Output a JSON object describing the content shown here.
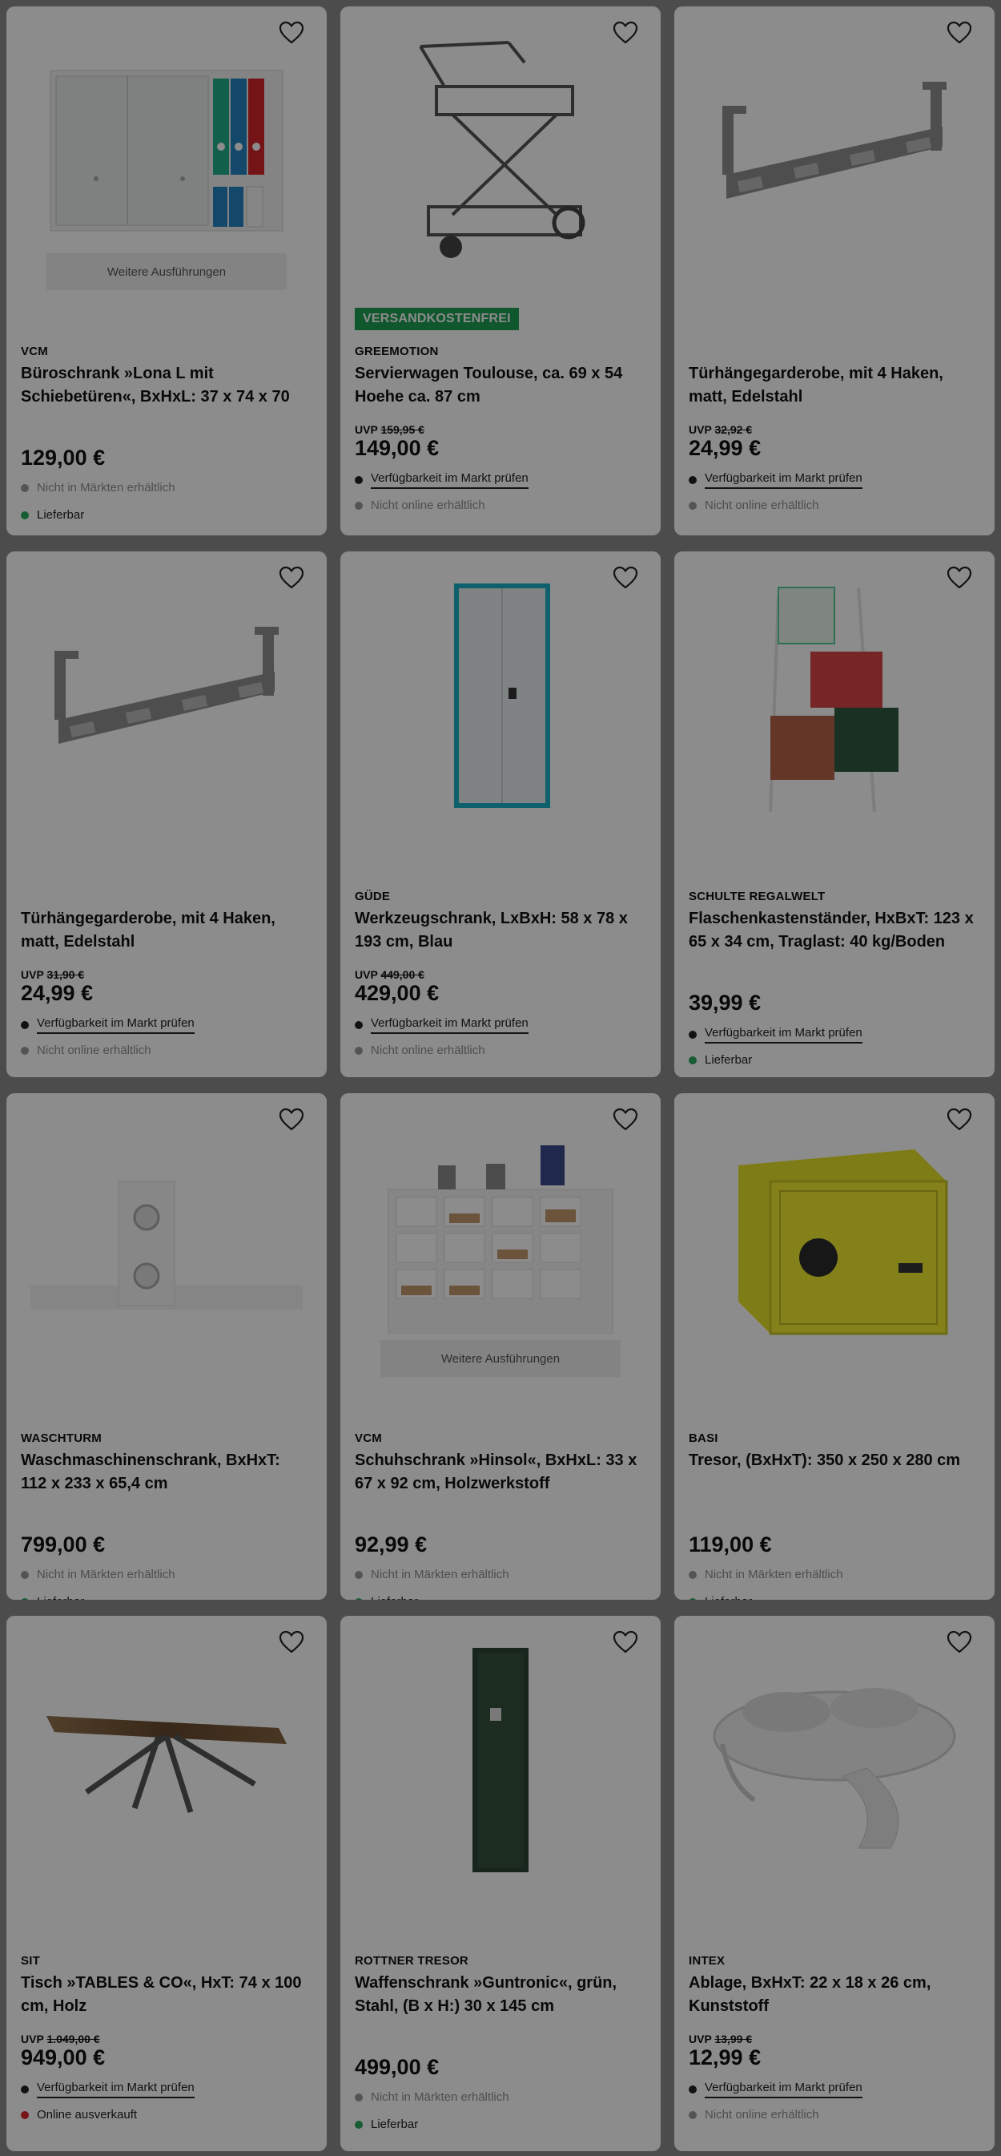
{
  "more_label": "Weitere Ausführungen",
  "colors": {
    "green": "#2aa85e",
    "red": "#d9262c",
    "dark": "#222222",
    "gray": "#9a9a9a",
    "badge": "#1e9e55"
  },
  "products": [
    {
      "brand": "VCM",
      "title": "Büroschrank »Lona L mit Schiebetüren«, BxHxL: 37 x 74 x 70 c…",
      "uvp_label": "",
      "uvp_value": "",
      "price": "129,00 €",
      "badge": "",
      "more": true,
      "image": "office-cabinet-image",
      "status": [
        {
          "text": "Nicht in Märkten erhältlich",
          "dot": "gray",
          "kind": "muted"
        },
        {
          "text": "Lieferbar",
          "dot": "green",
          "kind": "plain"
        }
      ]
    },
    {
      "brand": "GREEMOTION",
      "title": "Servierwagen Toulouse, ca. 69 x 54 Hoehe ca. 87 cm",
      "uvp_label": "UVP",
      "uvp_value": "159,95 €",
      "price": "149,00 €",
      "badge": "VERSANDKOSTENFREI",
      "more": false,
      "image": "serving-cart-image",
      "status": [
        {
          "text": "Verfügbarkeit im Markt prüfen",
          "dot": "dark",
          "kind": "link"
        },
        {
          "text": "Nicht online erhältlich",
          "dot": "gray",
          "kind": "muted"
        }
      ]
    },
    {
      "brand": "",
      "title": "Türhängegarderobe, mit 4 Haken, matt, Edelstahl",
      "uvp_label": "UVP",
      "uvp_value": "32,92 €",
      "price": "24,99 €",
      "badge": "",
      "more": false,
      "image": "door-hook-rack-image",
      "status": [
        {
          "text": "Verfügbarkeit im Markt prüfen",
          "dot": "dark",
          "kind": "link"
        },
        {
          "text": "Nicht online erhältlich",
          "dot": "gray",
          "kind": "muted"
        }
      ]
    },
    {
      "brand": "",
      "title": "Türhängegarderobe, mit 4 Haken, matt, Edelstahl",
      "uvp_label": "UVP",
      "uvp_value": "31,90 €",
      "price": "24,99 €",
      "badge": "",
      "more": false,
      "image": "door-hook-rack-image",
      "status": [
        {
          "text": "Verfügbarkeit im Markt prüfen",
          "dot": "dark",
          "kind": "link"
        },
        {
          "text": "Nicht online erhältlich",
          "dot": "gray",
          "kind": "muted"
        }
      ]
    },
    {
      "brand": "GÜDE",
      "title": "Werkzeugschrank, LxBxH: 58 x 78 x 193 cm, Blau",
      "uvp_label": "UVP",
      "uvp_value": "449,00 €",
      "price": "429,00 €",
      "badge": "",
      "more": false,
      "image": "tool-cabinet-image",
      "status": [
        {
          "text": "Verfügbarkeit im Markt prüfen",
          "dot": "dark",
          "kind": "link"
        },
        {
          "text": "Nicht online erhältlich",
          "dot": "gray",
          "kind": "muted"
        }
      ]
    },
    {
      "brand": "SCHULTE REGALWELT",
      "title": "Flaschenkastenständer, HxBxT: 123 x 65 x 34 cm, Traglast: 40 kg/Boden",
      "uvp_label": "",
      "uvp_value": "",
      "price": "39,99 €",
      "badge": "",
      "more": false,
      "image": "crate-stand-image",
      "status": [
        {
          "text": "Verfügbarkeit im Markt prüfen",
          "dot": "dark",
          "kind": "link"
        },
        {
          "text": "Lieferbar",
          "dot": "green",
          "kind": "plain"
        }
      ]
    },
    {
      "brand": "WASCHTURM",
      "title": "Waschmaschinenschrank, BxHxT: 112 x 233 x 65,4 cm",
      "uvp_label": "",
      "uvp_value": "",
      "price": "799,00 €",
      "badge": "",
      "more": false,
      "image": "washer-cabinet-image",
      "status": [
        {
          "text": "Nicht in Märkten erhältlich",
          "dot": "gray",
          "kind": "muted"
        },
        {
          "text": "Lieferbar",
          "dot": "green",
          "kind": "plain"
        }
      ]
    },
    {
      "brand": "VCM",
      "title": "Schuhschrank »Hinsol«, BxHxL: 33 x 67 x 92 cm, Holzwerkstoff",
      "uvp_label": "",
      "uvp_value": "",
      "price": "92,99 €",
      "badge": "",
      "more": true,
      "image": "shoe-cabinet-image",
      "status": [
        {
          "text": "Nicht in Märkten erhältlich",
          "dot": "gray",
          "kind": "muted"
        },
        {
          "text": "Lieferbar",
          "dot": "green",
          "kind": "plain"
        }
      ]
    },
    {
      "brand": "BASI",
      "title": "Tresor, (BxHxT): 350 x 250 x 280 cm",
      "uvp_label": "",
      "uvp_value": "",
      "price": "119,00 €",
      "badge": "",
      "more": false,
      "image": "safe-image",
      "status": [
        {
          "text": "Nicht in Märkten erhältlich",
          "dot": "gray",
          "kind": "muted"
        },
        {
          "text": "Lieferbar",
          "dot": "green",
          "kind": "plain"
        }
      ]
    },
    {
      "brand": "SIT",
      "title": "Tisch »TABLES & CO«, HxT: 74 x 100 cm, Holz",
      "uvp_label": "UVP",
      "uvp_value": "1.049,00 €",
      "price": "949,00 €",
      "badge": "",
      "more": false,
      "image": "table-image",
      "status": [
        {
          "text": "Verfügbarkeit im Markt prüfen",
          "dot": "dark",
          "kind": "link"
        },
        {
          "text": "Online ausverkauft",
          "dot": "red",
          "kind": "plain"
        }
      ]
    },
    {
      "brand": "ROTTNER TRESOR",
      "title": "Waffenschrank »Guntronic«, grün, Stahl, (B x H:) 30 x 145 cm",
      "uvp_label": "",
      "uvp_value": "",
      "price": "499,00 €",
      "badge": "",
      "more": false,
      "image": "gun-cabinet-image",
      "status": [
        {
          "text": "Nicht in Märkten erhältlich",
          "dot": "gray",
          "kind": "muted"
        },
        {
          "text": "Lieferbar",
          "dot": "green",
          "kind": "plain"
        }
      ]
    },
    {
      "brand": "INTEX",
      "title": "Ablage, BxHxT: 22 x 18 x 26 cm, Kunststoff",
      "uvp_label": "UVP",
      "uvp_value": "13,99 €",
      "price": "12,99 €",
      "badge": "",
      "more": false,
      "image": "pool-tray-image",
      "status": [
        {
          "text": "Verfügbarkeit im Markt prüfen",
          "dot": "dark",
          "kind": "link"
        },
        {
          "text": "Nicht online erhältlich",
          "dot": "gray",
          "kind": "muted"
        }
      ]
    }
  ]
}
